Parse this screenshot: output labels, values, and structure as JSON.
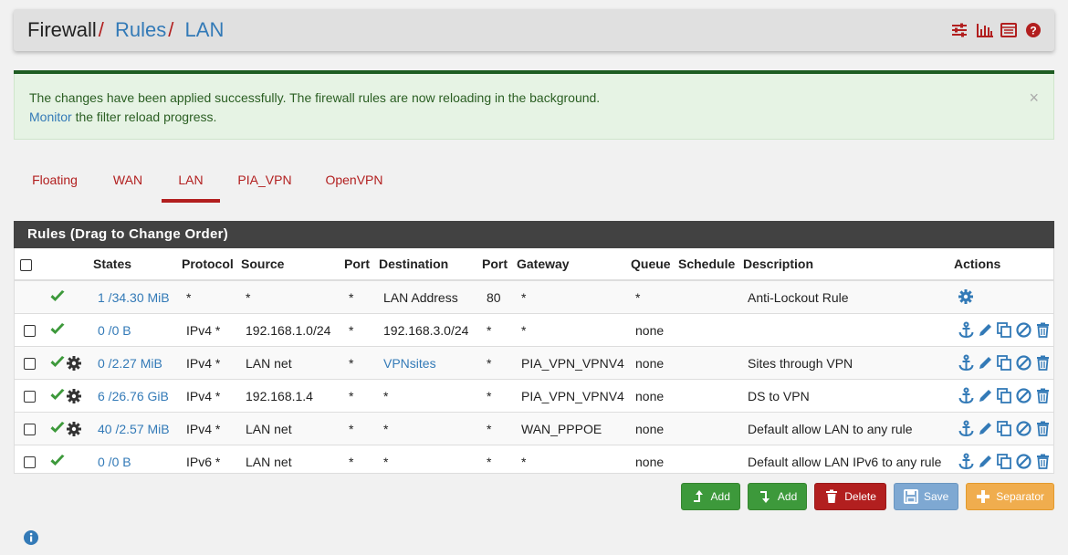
{
  "header": {
    "crumb_root": "Firewall",
    "crumb_sep": "/",
    "crumb_rules": "Rules",
    "crumb_lan": "LAN",
    "icons": [
      "sliders-icon",
      "bar-chart-icon",
      "table-icon",
      "help-icon"
    ]
  },
  "alert": {
    "line1": "The changes have been applied successfully. The firewall rules are now reloading in the background.",
    "link": "Monitor",
    "line2_rest": " the filter reload progress.",
    "close": "×"
  },
  "tabs": [
    "Floating",
    "WAN",
    "LAN",
    "PIA_VPN",
    "OpenVPN"
  ],
  "active_tab": "LAN",
  "panel": {
    "title": "Rules (Drag to Change Order)",
    "columns": [
      "States",
      "Protocol",
      "Source",
      "Port",
      "Destination",
      "Port",
      "Gateway",
      "Queue",
      "Schedule",
      "Description",
      "Actions"
    ]
  },
  "rules": [
    {
      "states": "1 /34.30 MiB",
      "protocol": "*",
      "source": "*",
      "sport": "*",
      "destination": "LAN Address",
      "dport": "80",
      "gateway": "*",
      "queue": "*",
      "schedule": "",
      "description": "Anti-Lockout Rule"
    },
    {
      "states": "0 /0 B",
      "protocol": "IPv4 *",
      "source": "192.168.1.0/24",
      "sport": "*",
      "destination": "192.168.3.0/24",
      "dport": "*",
      "gateway": "*",
      "queue": "none",
      "schedule": "",
      "description": ""
    },
    {
      "states": "0 /2.27 MiB",
      "protocol": "IPv4 *",
      "source": "LAN net",
      "sport": "*",
      "destination": "VPNsites",
      "dport": "*",
      "gateway": "PIA_VPN_VPNV4",
      "queue": "none",
      "schedule": "",
      "description": "Sites through VPN"
    },
    {
      "states": "6 /26.76 GiB",
      "protocol": "IPv4 *",
      "source": "192.168.1.4",
      "sport": "*",
      "destination": "*",
      "dport": "*",
      "gateway": "PIA_VPN_VPNV4",
      "queue": "none",
      "schedule": "",
      "description": "DS to VPN"
    },
    {
      "states": "40 /2.57 MiB",
      "protocol": "IPv4 *",
      "source": "LAN net",
      "sport": "*",
      "destination": "*",
      "dport": "*",
      "gateway": "WAN_PPPOE",
      "queue": "none",
      "schedule": "",
      "description": "Default allow LAN to any rule"
    },
    {
      "states": "0 /0 B",
      "protocol": "IPv6 *",
      "source": "LAN net",
      "sport": "*",
      "destination": "*",
      "dport": "*",
      "gateway": "*",
      "queue": "none",
      "schedule": "",
      "description": "Default allow LAN IPv6 to any rule"
    }
  ],
  "buttons": {
    "add_top": "Add",
    "add_bottom": "Add",
    "delete": "Delete",
    "save": "Save",
    "separator": "Separator"
  },
  "colors": {
    "accent_red": "#b21f1f",
    "link_blue": "#337ab7",
    "check_green": "#3d993b",
    "panel_header": "#424242"
  }
}
